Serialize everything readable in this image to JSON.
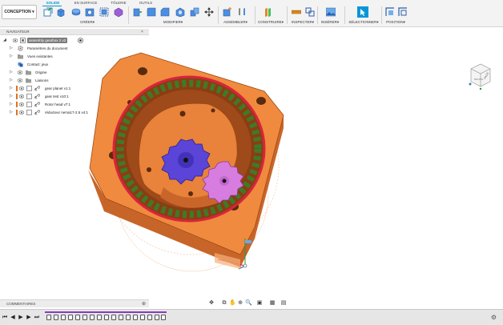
{
  "toolbar": {
    "workspace_label": "CONCEPTION",
    "tabs": [
      "SOLIDE",
      "EN SURFACE",
      "TÔLERIE",
      "OUTILS"
    ],
    "active_tab_index": 0,
    "groups": [
      "CRÉER",
      "MODIFIER",
      "ASSEMBLER",
      "CONSTRUIRE",
      "INSPECTER",
      "INSÉRER",
      "SÉLECTIONNER",
      "POSITION"
    ],
    "dropdown_glyph": "▾"
  },
  "browser": {
    "title": "NAVIGATEUR",
    "root": "assembly gearbox 2 v2",
    "items": [
      {
        "label": "Paramètres du document",
        "icon": "gear-icon"
      },
      {
        "label": "Vues existantes",
        "icon": "folder-icon"
      },
      {
        "label": "Contact: jeux",
        "icon": "contact-icon"
      },
      {
        "label": "Origine",
        "icon": "folder-icon"
      },
      {
        "label": "Liaisons",
        "icon": "folder-icon"
      },
      {
        "label": "gear planet v1:1",
        "icon": "component-icon"
      },
      {
        "label": "gear test v10:1",
        "icon": "component-icon"
      },
      {
        "label": "Rotor head v7:1",
        "icon": "component-icon"
      },
      {
        "label": "réducteur nema17-2.5 v4:1",
        "icon": "component-icon"
      }
    ]
  },
  "comments": {
    "title": "COMMENTAIRES"
  },
  "viewcube": {
    "label": "FACE",
    "label_side": "DROITE"
  },
  "colors": {
    "accent": "#0696d7",
    "body_orange": "#f08a3e",
    "ring_red": "#d8243c",
    "planet_magenta": "#d87de0",
    "sun_blue": "#5a45d8",
    "timeline_marker": "#8a3bbf"
  }
}
